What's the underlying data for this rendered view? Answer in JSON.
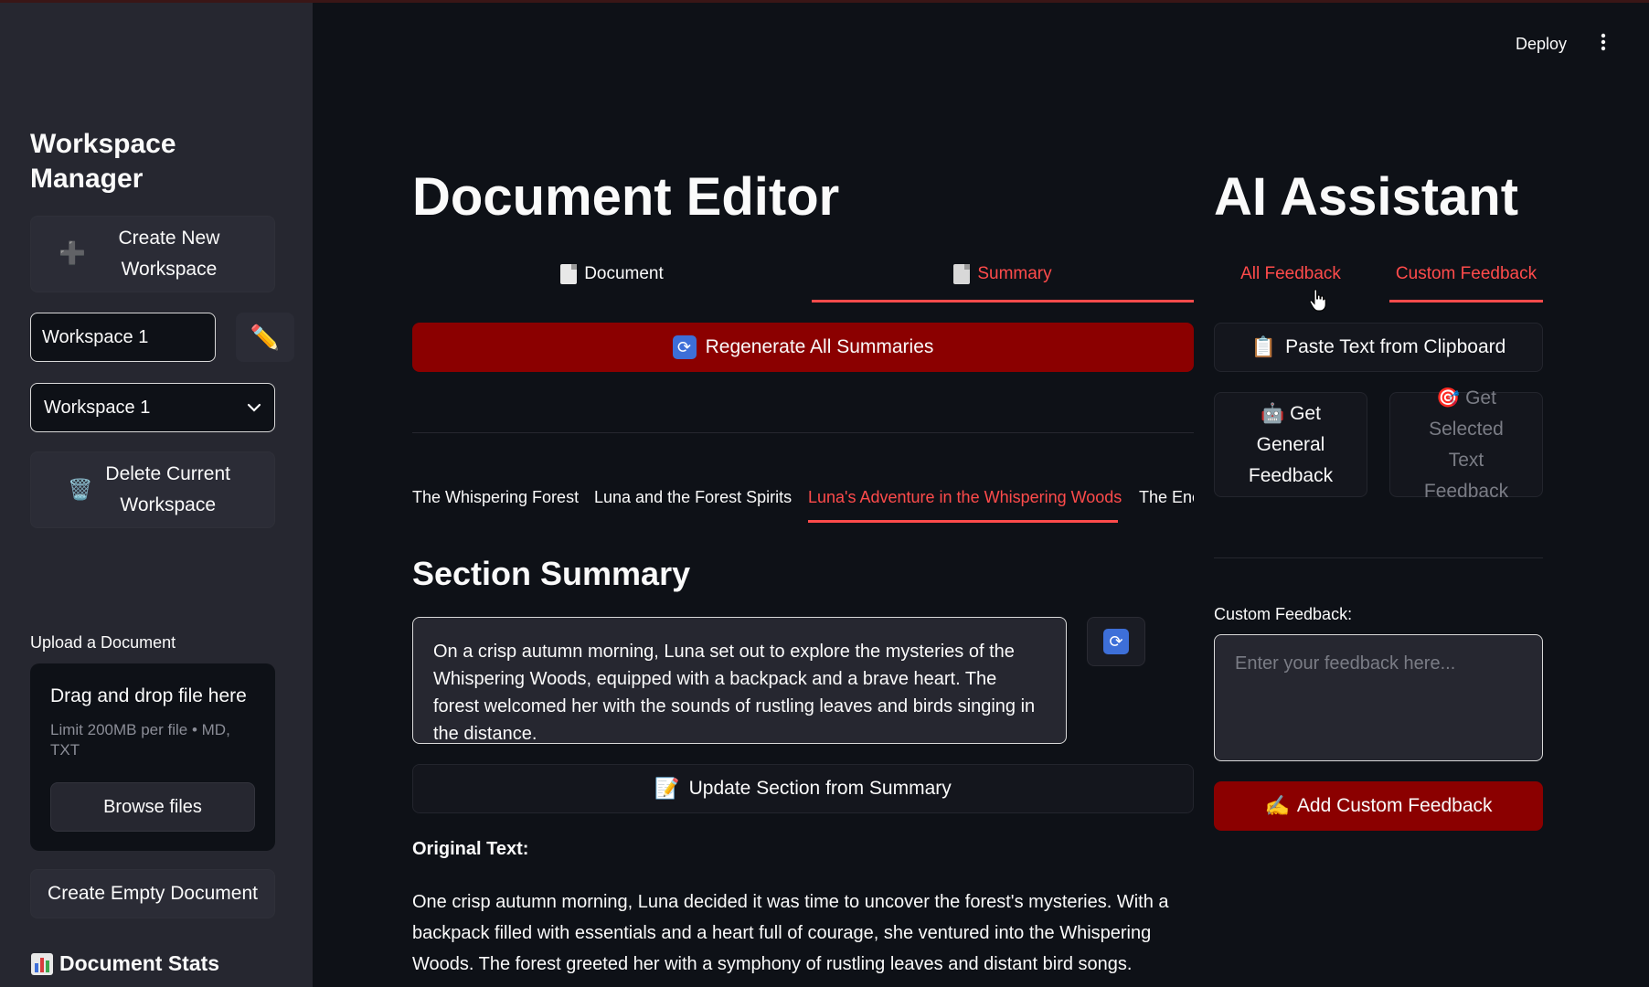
{
  "sidebar": {
    "title": "Workspace Manager",
    "create_workspace": "Create New Workspace",
    "workspace_name_value": "Workspace 1",
    "workspace_select_value": "Workspace 1",
    "delete_workspace": "Delete Current Workspace",
    "upload_label": "Upload a Document",
    "upload_drag_text": "Drag and drop file here",
    "upload_limit_text": "Limit 200MB per file • MD, TXT",
    "browse_label": "Browse files",
    "create_empty": "Create Empty Document",
    "stats_title": "Document Stats"
  },
  "topbar": {
    "deploy": "Deploy"
  },
  "editor": {
    "title": "Document Editor",
    "tabs": [
      "Document",
      "Summary"
    ],
    "active_tab": "Summary",
    "regenerate_label": "Regenerate All Summaries",
    "section_tabs": [
      "The Whispering Forest",
      "Luna and the Forest Spirits",
      "Luna's Adventure in the Whispering Woods",
      "The Enc"
    ],
    "active_section_tab": "Luna's Adventure in the Whispering Woods",
    "section_summary_heading": "Section Summary",
    "summary_text": "On a crisp autumn morning, Luna set out to explore the mysteries of the Whispering Woods, equipped with a backpack and a brave heart. The forest welcomed her with the sounds of rustling leaves and birds singing in the distance.",
    "update_label": "Update Section from Summary",
    "original_label": "Original Text:",
    "original_text": "One crisp autumn morning, Luna decided it was time to uncover the forest's mysteries. With a backpack filled with essentials and a heart full of courage, she ventured into the Whispering Woods. The forest greeted her with a symphony of rustling leaves and distant bird songs."
  },
  "assistant": {
    "title": "AI Assistant",
    "tabs": [
      "All Feedback",
      "Custom Feedback"
    ],
    "active_tab": "Custom Feedback",
    "paste_label": "Paste Text from Clipboard",
    "general_feedback": "Get General Feedback",
    "selected_feedback": "Get Selected Text Feedback",
    "custom_label": "Custom Feedback:",
    "custom_placeholder": "Enter your feedback here...",
    "add_label": "Add Custom Feedback"
  },
  "colors": {
    "accent": "#ff4b4b",
    "primary_button": "#8b0000",
    "background": "#0e1117",
    "sidebar": "#262730"
  }
}
